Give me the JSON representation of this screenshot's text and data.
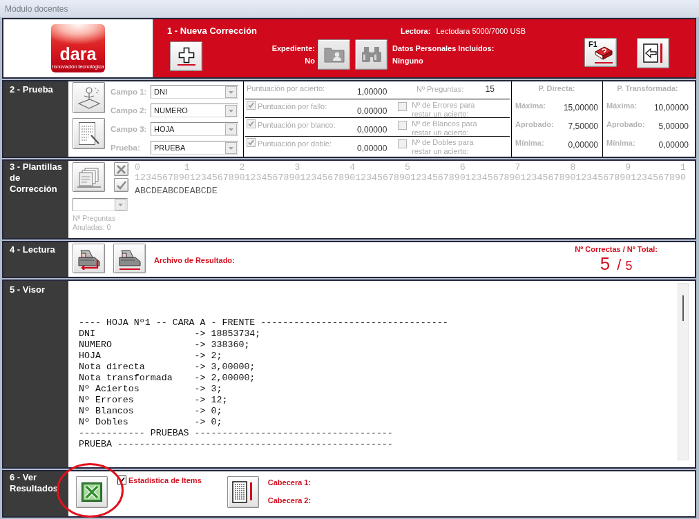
{
  "window": {
    "title": "Módulo docentes"
  },
  "header": {
    "logo": {
      "brand": "dara",
      "tagline": "Innovación tecnológica"
    },
    "title": "1 - Nueva Corrección",
    "reader": {
      "label": "Lectora:",
      "value": "Lectodara 5000/7000 USB"
    },
    "file": {
      "label": "Expediente:",
      "value": "No"
    },
    "personal_data": {
      "label": "Datos Personales Incluidos:",
      "value": "Ninguno"
    },
    "buttons": [
      {
        "kind": "new",
        "disabled": false
      },
      {
        "kind": "folder",
        "disabled": true
      },
      {
        "kind": "binoculars",
        "disabled": true
      },
      {
        "kind": "help",
        "label": "F1",
        "disabled": false
      },
      {
        "kind": "exit",
        "disabled": false
      }
    ]
  },
  "prueba": {
    "title": "2 - Prueba",
    "fields": [
      {
        "label": "Campo 1:",
        "value": "DNI",
        "disabled": true
      },
      {
        "label": "Campo 2:",
        "value": "NUMERO",
        "disabled": true
      },
      {
        "label": "Campo 3:",
        "value": "HOJA",
        "disabled": true
      },
      {
        "label": "Prueba:",
        "value": "PRUEBA",
        "disabled": true
      }
    ],
    "scoring": [
      {
        "kind": "plain",
        "label": "Puntuación por acierto:",
        "value": "1,00000",
        "disabled": true,
        "count_label": "Nº Preguntas:",
        "count_value": "15"
      },
      {
        "kind": "check",
        "label": "Puntuación por fallo:",
        "checked": true,
        "value": "0,00000",
        "disabled": true,
        "limit_checked": false,
        "limit_label": "Nº de Errores para restar un acierto:"
      },
      {
        "kind": "check",
        "label": "Puntuación por blanco:",
        "checked": true,
        "value": "0,00000",
        "disabled": true,
        "limit_checked": false,
        "limit_label": "Nº de Blancos para restar un acierto:"
      },
      {
        "kind": "check",
        "label": "Puntuación por doble:",
        "checked": true,
        "value": "0,00000",
        "disabled": true,
        "limit_checked": false,
        "limit_label": "Nº de Dobles para restar un acierto:"
      }
    ],
    "summary": [
      {
        "title": "P. Directa:",
        "rows": [
          {
            "label": "Máxima:",
            "value": "15,00000"
          },
          {
            "label": "Aprobado:",
            "value": "7,50000"
          },
          {
            "label": "Mínima:",
            "value": "0,00000"
          }
        ]
      },
      {
        "title": "P. Transformada:",
        "rows": [
          {
            "label": "Máxima:",
            "value": "10,00000"
          },
          {
            "label": "Aprobado:",
            "value": "5,00000"
          },
          {
            "label": "Mínima:",
            "value": "0,00000"
          }
        ]
      }
    ]
  },
  "templates": {
    "title": "3 - Plantillas de Corrección",
    "ruler_tens": "0        1         2         3         4         5         6         7         8         9         1",
    "ruler_units": "1234567890123456789012345678901234567890123456789012345678901234567890123456789012345678901234567890",
    "answers": "ABCDEABCDEABCDE",
    "annulled": "Nº Preguntas Anuladas: 0"
  },
  "reading": {
    "title": "4 - Lectura",
    "result_label": "Archivo de Resultado:",
    "score_label": "Nº Correctas / Nº Total:",
    "correct": "5",
    "separator": "/",
    "total": "5"
  },
  "viewer": {
    "title": "5 - Visor",
    "lines": [
      "---- HOJA Nº1 -- CARA A - FRENTE ----------------------------------",
      "DNI                  -> 18853734;",
      "NUMERO               -> 338360;",
      "HOJA                 -> 2;",
      "Nota directa         -> 3,00000;",
      "Nota transformada    -> 2,00000;",
      "Nº Aciertos          -> 3;",
      "Nº Errores           -> 12;",
      "Nº Blancos           -> 0;",
      "Nº Dobles            -> 0;",
      "------------ PRUEBAS ------------------------------------",
      "PRUEBA --------------------------------------------------"
    ]
  },
  "results": {
    "title": "6 - Ver Resultados",
    "stats": {
      "label": "Estadística de Items",
      "checked": true
    },
    "headers": [
      "Cabecera 1:",
      "Cabecera 2:"
    ]
  }
}
